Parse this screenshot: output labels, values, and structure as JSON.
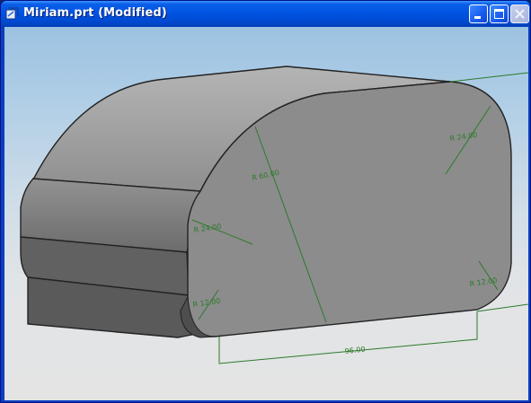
{
  "window": {
    "title": "Miriam.prt (Modified)"
  },
  "buttons": {
    "minimize": "minimize-icon",
    "maximize": "maximize-icon",
    "close": "close-icon"
  },
  "dimensions": {
    "r60": "R 60.00",
    "r24_left": "R 24.00",
    "r24_right": "R 24.00",
    "r12_left": "R 12.00",
    "r12_right": "R 12.00",
    "width": "96.00"
  },
  "colors": {
    "dimension_green": "#2b7a2b",
    "face_gray": "#8c8c8c",
    "titlebar_blue": "#0054e3"
  }
}
